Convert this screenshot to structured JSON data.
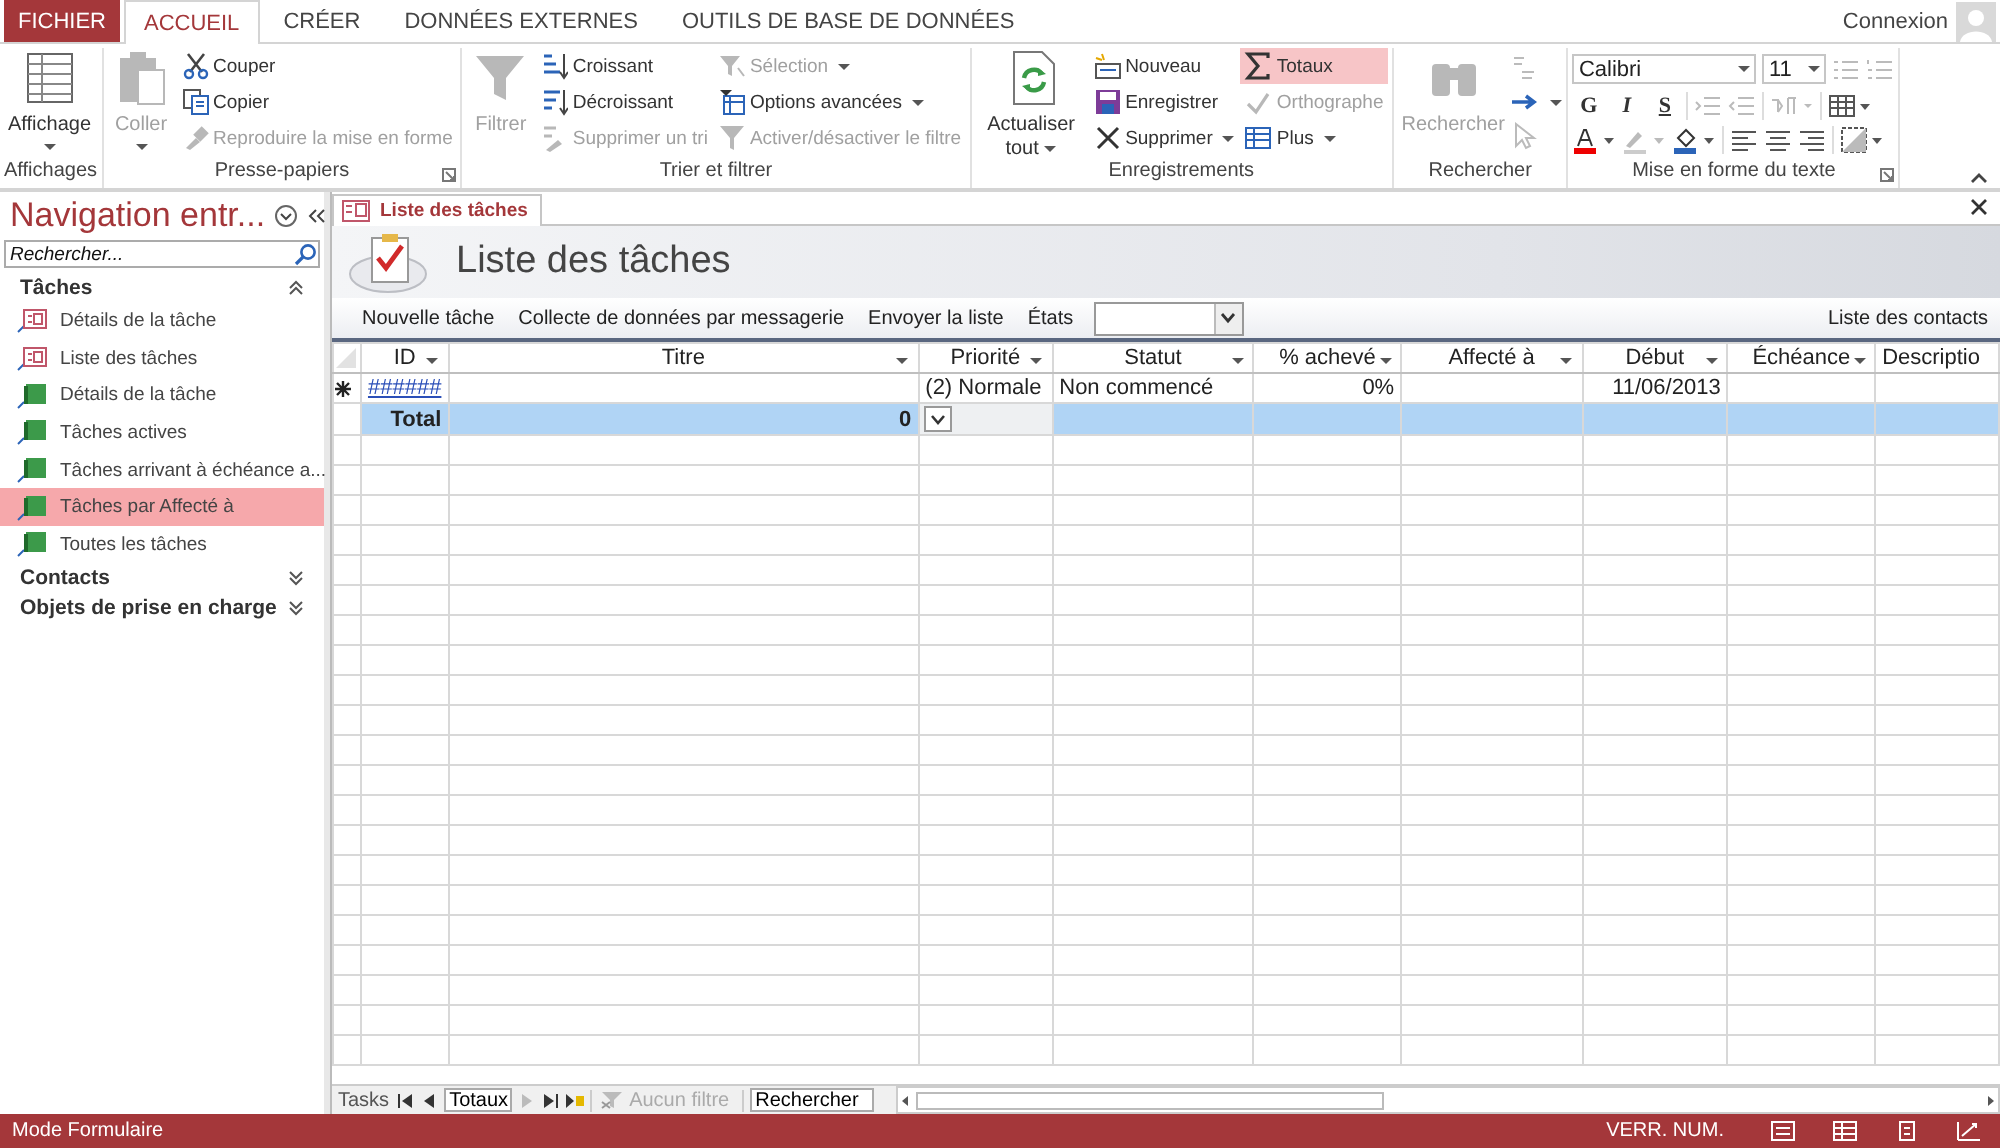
{
  "ribbon_tabs": [
    {
      "label": "FICHIER",
      "kind": "file",
      "selected": false
    },
    {
      "label": "ACCUEIL",
      "kind": "tab",
      "selected": true
    },
    {
      "label": "CRÉER",
      "kind": "tab",
      "selected": false
    },
    {
      "label": "DONNÉES EXTERNES",
      "kind": "tab",
      "selected": false
    },
    {
      "label": "OUTILS DE BASE DE DONNÉES",
      "kind": "tab",
      "selected": false
    }
  ],
  "account": {
    "label": "Connexion"
  },
  "ribbon": {
    "groups": [
      {
        "label": "Affichages",
        "large": [
          {
            "label": "Affichage",
            "disabled": false,
            "dropdown": true
          }
        ]
      },
      {
        "label": "Presse-papiers",
        "large": [
          {
            "label": "Coller",
            "disabled": true,
            "dropdown": true
          }
        ],
        "columns": [
          [
            {
              "label": "Couper",
              "disabled": false,
              "dropdown": false,
              "on": false
            },
            {
              "label": "Copier",
              "disabled": false,
              "dropdown": false,
              "on": false
            },
            {
              "label": "Reproduire la mise en forme",
              "disabled": true,
              "dropdown": false,
              "on": false
            }
          ]
        ]
      },
      {
        "label": "Trier et filtrer",
        "large": [
          {
            "label": "Filtrer",
            "disabled": true,
            "dropdown": false
          }
        ],
        "columns": [
          [
            {
              "label": "Croissant",
              "disabled": false,
              "dropdown": false,
              "on": false
            },
            {
              "label": "Décroissant",
              "disabled": false,
              "dropdown": false,
              "on": false
            },
            {
              "label": "Supprimer un tri",
              "disabled": true,
              "dropdown": false,
              "on": false
            }
          ],
          [
            {
              "label": "Sélection",
              "disabled": true,
              "dropdown": true,
              "on": false
            },
            {
              "label": "Options avancées",
              "disabled": false,
              "dropdown": true,
              "on": false
            },
            {
              "label": "Activer/désactiver le filtre",
              "disabled": true,
              "dropdown": false,
              "on": false
            }
          ]
        ]
      },
      {
        "label": "Enregistrements",
        "large": [
          {
            "label": "Actualiser tout",
            "disabled": false,
            "dropdown": true
          }
        ],
        "columns": [
          [
            {
              "label": "Nouveau",
              "disabled": false,
              "dropdown": false,
              "on": false
            },
            {
              "label": "Enregistrer",
              "disabled": false,
              "dropdown": false,
              "on": false
            },
            {
              "label": "Supprimer",
              "disabled": false,
              "dropdown": true,
              "on": false
            }
          ],
          [
            {
              "label": "Totaux",
              "disabled": false,
              "dropdown": false,
              "on": true
            },
            {
              "label": "Orthographe",
              "disabled": true,
              "dropdown": false,
              "on": false
            },
            {
              "label": "Plus",
              "disabled": false,
              "dropdown": true,
              "on": false
            }
          ]
        ]
      },
      {
        "label": "Rechercher",
        "large": [
          {
            "label": "Rechercher",
            "disabled": true,
            "dropdown": false
          }
        ]
      },
      {
        "label": "Mise en forme du texte",
        "font": "Calibri",
        "size": "11",
        "styles": [
          "G",
          "I",
          "S"
        ]
      }
    ]
  },
  "navigation": {
    "title": "Navigation entr...",
    "search": {
      "placeholder": "Rechercher..."
    },
    "groups": [
      {
        "label": "Tâches",
        "expanded": true,
        "items": [
          {
            "label": "Détails de la tâche",
            "kind": "form",
            "selected": false
          },
          {
            "label": "Liste des tâches",
            "kind": "form",
            "selected": false
          },
          {
            "label": "Détails de la tâche",
            "kind": "report",
            "selected": false
          },
          {
            "label": "Tâches actives",
            "kind": "report",
            "selected": false
          },
          {
            "label": "Tâches arrivant à échéance a...",
            "kind": "report",
            "selected": false
          },
          {
            "label": "Tâches par Affecté à",
            "kind": "report",
            "selected": true
          },
          {
            "label": "Toutes les tâches",
            "kind": "report",
            "selected": false
          }
        ]
      },
      {
        "label": "Contacts",
        "expanded": false
      },
      {
        "label": "Objets de prise en charge",
        "expanded": false
      }
    ]
  },
  "document_tab": {
    "label": "Liste des tâches",
    "selected": true
  },
  "form": {
    "title": "Liste des tâches",
    "actions": [
      "Nouvelle tâche",
      "Collecte de données par messagerie",
      "Envoyer la liste"
    ],
    "reports": {
      "label": "États"
    },
    "contacts_link": "Liste des contacts",
    "columns": [
      {
        "label": "ID",
        "kind": "link",
        "total_picker": false
      },
      {
        "label": "Titre",
        "kind": "text",
        "total": "0",
        "total_picker": false
      },
      {
        "label": "Priorité",
        "kind": "text",
        "total_picker": true
      },
      {
        "label": "Statut",
        "kind": "text",
        "total_picker": false
      },
      {
        "label": "% achevé",
        "kind": "number",
        "total_picker": false
      },
      {
        "label": "Affecté à",
        "kind": "text",
        "total_picker": false
      },
      {
        "label": "Début",
        "kind": "number",
        "total_picker": false
      },
      {
        "label": "Échéance",
        "kind": "number",
        "total_picker": false
      },
      {
        "label": "Descriptio",
        "kind": "text",
        "total_picker": false
      }
    ],
    "rows": [
      {
        "new_record": true,
        "cells": [
          "######",
          null,
          "(2) Normale",
          "Non commencé",
          "0%",
          null,
          "11/06/2013",
          null,
          null
        ]
      }
    ],
    "total_row": {
      "label": "Total"
    },
    "record_nav": {
      "label": "Tasks",
      "record": "Totaux",
      "filter": "Aucun filtre",
      "search": {
        "placeholder": "Rechercher"
      }
    }
  },
  "status_bar": {
    "mode": "Mode Formulaire",
    "indicators": [
      "VERR. NUM."
    ]
  }
}
